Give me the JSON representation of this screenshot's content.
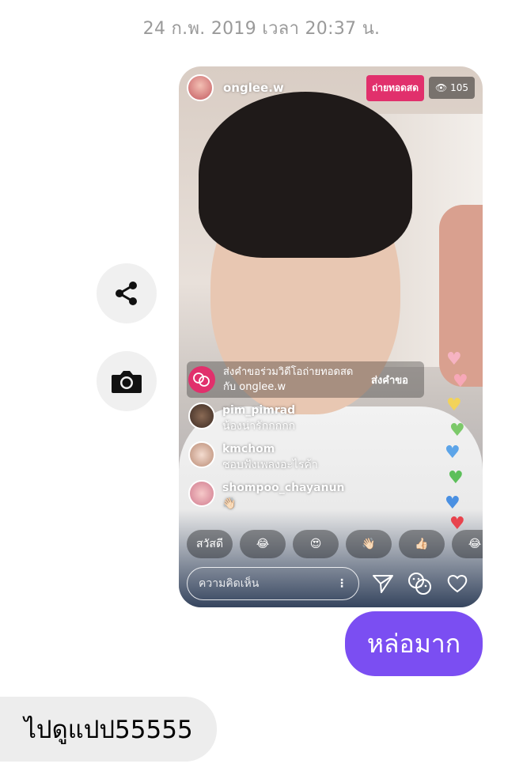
{
  "timestamp": "24 ก.พ. 2019 เวลา 20:37 น.",
  "side_actions": {
    "share_icon": "share-icon",
    "camera_icon": "camera-icon"
  },
  "live": {
    "username": "onglee.w",
    "live_badge": "ถ่ายทอดสด",
    "viewer_count": "105",
    "request_text": "ส่งคำขอร่วมวิดีโอถ่ายทอดสดกับ onglee.w",
    "request_button": "ส่งคำขอ",
    "comments": [
      {
        "user": "pim_pimrad",
        "text": "น้องน่ารักกกกก"
      },
      {
        "user": "kmchom",
        "text": "ชอบฟังเพลงอะไรค้า"
      },
      {
        "user": "shompoo_chayanun",
        "text": "👋🏻"
      }
    ],
    "quick_replies": [
      "สวัสดี",
      "😂",
      "😍",
      "👋🏻",
      "👍🏻",
      "😂"
    ],
    "comment_placeholder": "ความคิดเห็น"
  },
  "messages": {
    "sent": "หล่อมาก",
    "received": "ไปดูแปป55555"
  },
  "colors": {
    "sent_bubble": "#7b4ef2",
    "received_bubble": "#ededed",
    "live_badge": "#e1306c"
  }
}
